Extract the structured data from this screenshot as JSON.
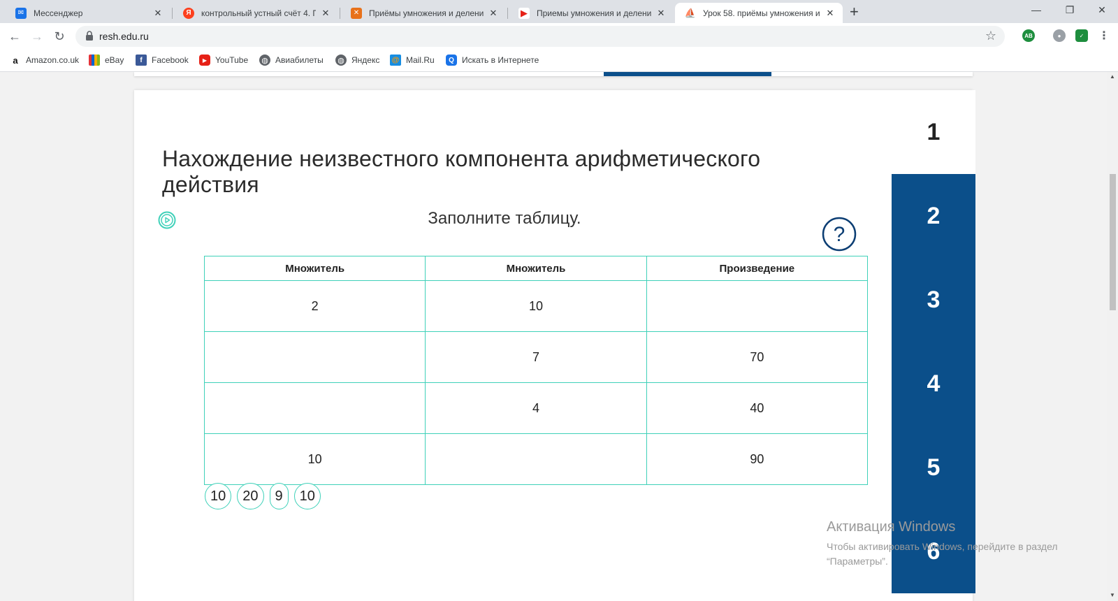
{
  "tabs": [
    {
      "title": "Мессенджер",
      "favicon": "messenger-icon",
      "color": "#1a73e8"
    },
    {
      "title": "контрольный устный счёт 4. Пр",
      "favicon": "yandex-icon",
      "color": "#fc3f1d"
    },
    {
      "title": "Приёмы умножения и деления",
      "favicon": "slides-icon",
      "color": "#e8711a"
    },
    {
      "title": "Приемы умножения и деления",
      "favicon": "play-red-icon",
      "color": "#e62117"
    },
    {
      "title": "Урок 58. приёмы умножения и",
      "favicon": "resh-icon",
      "color": "#8fa3c4",
      "active": true
    }
  ],
  "omnibox": {
    "url": "resh.edu.ru"
  },
  "bookmarks": [
    {
      "label": "Amazon.co.uk",
      "icon": "amazon-icon"
    },
    {
      "label": "eBay",
      "icon": "ebay-icon"
    },
    {
      "label": "Facebook",
      "icon": "facebook-icon"
    },
    {
      "label": "YouTube",
      "icon": "youtube-icon"
    },
    {
      "label": "Авиабилеты",
      "icon": "globe-icon"
    },
    {
      "label": "Яндекс",
      "icon": "globe-icon"
    },
    {
      "label": "Mail.Ru",
      "icon": "mailru-icon"
    },
    {
      "label": "Искать в Интернете",
      "icon": "search-icon"
    }
  ],
  "lesson": {
    "title": "Нахождение неизвестного компонента арифметического действия",
    "instruction": "Заполните таблицу."
  },
  "table": {
    "headers": [
      "Множитель",
      "Множитель",
      "Произведение"
    ],
    "rows": [
      [
        "2",
        "10",
        ""
      ],
      [
        "",
        "7",
        "70"
      ],
      [
        "",
        "4",
        "40"
      ],
      [
        "10",
        "",
        "90"
      ]
    ]
  },
  "answer_options": [
    "10",
    "20",
    "9",
    "10"
  ],
  "steps": [
    "1",
    "2",
    "3",
    "4",
    "5",
    "6"
  ],
  "current_step": "1",
  "watermark": {
    "title": "Активация Windows",
    "line1": "Чтобы активировать Windows, перейдите в раздел",
    "line2": "“Параметры”."
  },
  "colors": {
    "accent": "#0b4f8a",
    "teal": "#3fd1b9"
  }
}
